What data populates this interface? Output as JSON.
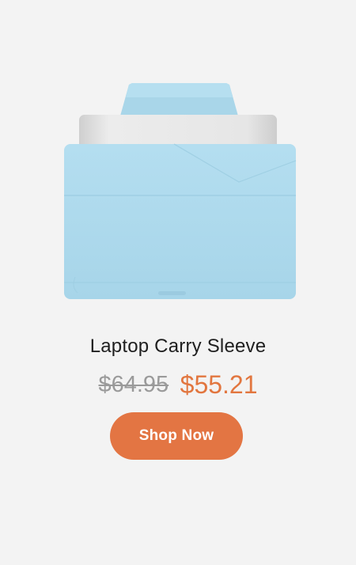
{
  "product": {
    "image_icon": "laptop-sleeve-image",
    "title": "Laptop Carry Sleeve",
    "original_price": "$64.95",
    "sale_price": "$55.21",
    "cta_label": "Shop Now"
  },
  "colors": {
    "background": "#f3f3f3",
    "sleeve": "#b8e0ef",
    "accent": "#e37543",
    "sale_price": "#e2763f",
    "old_price": "#9a9a9a",
    "title": "#1f1f1f"
  }
}
